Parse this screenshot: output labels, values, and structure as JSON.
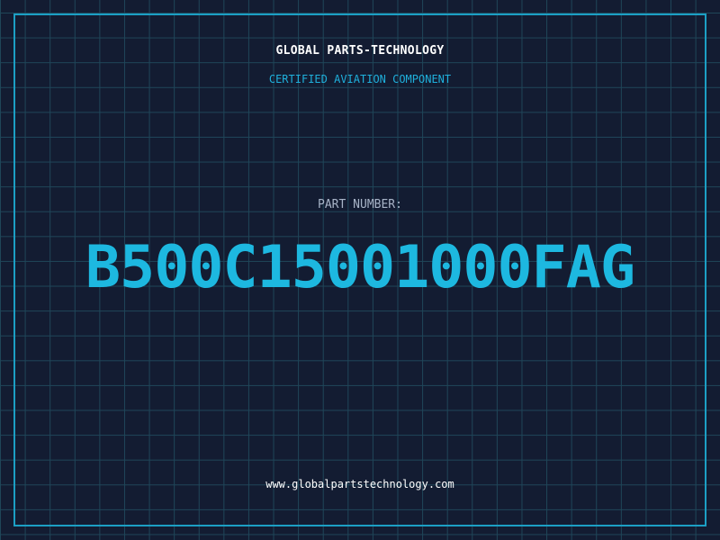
{
  "header": {
    "brand": "GLOBAL PARTS-TECHNOLOGY",
    "subtitle": "CERTIFIED AVIATION COMPONENT"
  },
  "main": {
    "part_label": "PART NUMBER:",
    "part_number": "B500C15001000FAG"
  },
  "footer": {
    "url": "www.globalpartstechnology.com"
  },
  "colors": {
    "background": "#131c32",
    "grid": "#1f4659",
    "accent": "#1db8e0",
    "frame": "#1c9fc4"
  }
}
